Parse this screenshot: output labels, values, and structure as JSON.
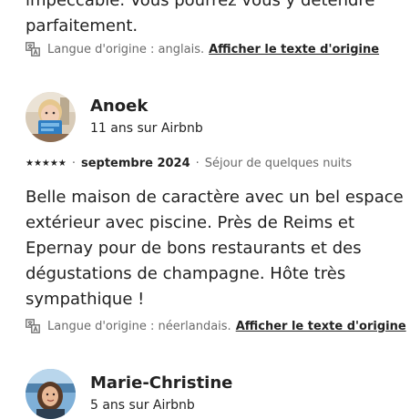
{
  "review_prev": {
    "text_lines": [
      "impeccable. Vous pourrez vous y détendre",
      "parfaitement."
    ],
    "original_language_label": "Langue d'origine : anglais.",
    "show_original_label": "Afficher le texte d'origine"
  },
  "review_anoek": {
    "name": "Anoek",
    "tenure": "11 ans sur Airbnb",
    "rating_stars": "★★★★★",
    "rating": 5,
    "date": "septembre 2024",
    "stay": "Séjour de quelques nuits",
    "text_lines": [
      "Belle maison de caractère avec un bel espace",
      "extérieur avec piscine. Près de Reims et",
      "Epernay pour de bons restaurants et des",
      "dégustations de champagne. Hôte très",
      "sympathique !"
    ],
    "original_language_label": "Langue d'origine : néerlandais.",
    "show_original_label": "Afficher le texte d'origine"
  },
  "review_marie": {
    "name": "Marie-Christine",
    "tenure": "5 ans sur Airbnb"
  },
  "colors": {
    "text_primary": "#222222",
    "text_secondary": "#6a6a6a"
  },
  "icons": {
    "translate": "translate-icon",
    "separator": "·"
  }
}
